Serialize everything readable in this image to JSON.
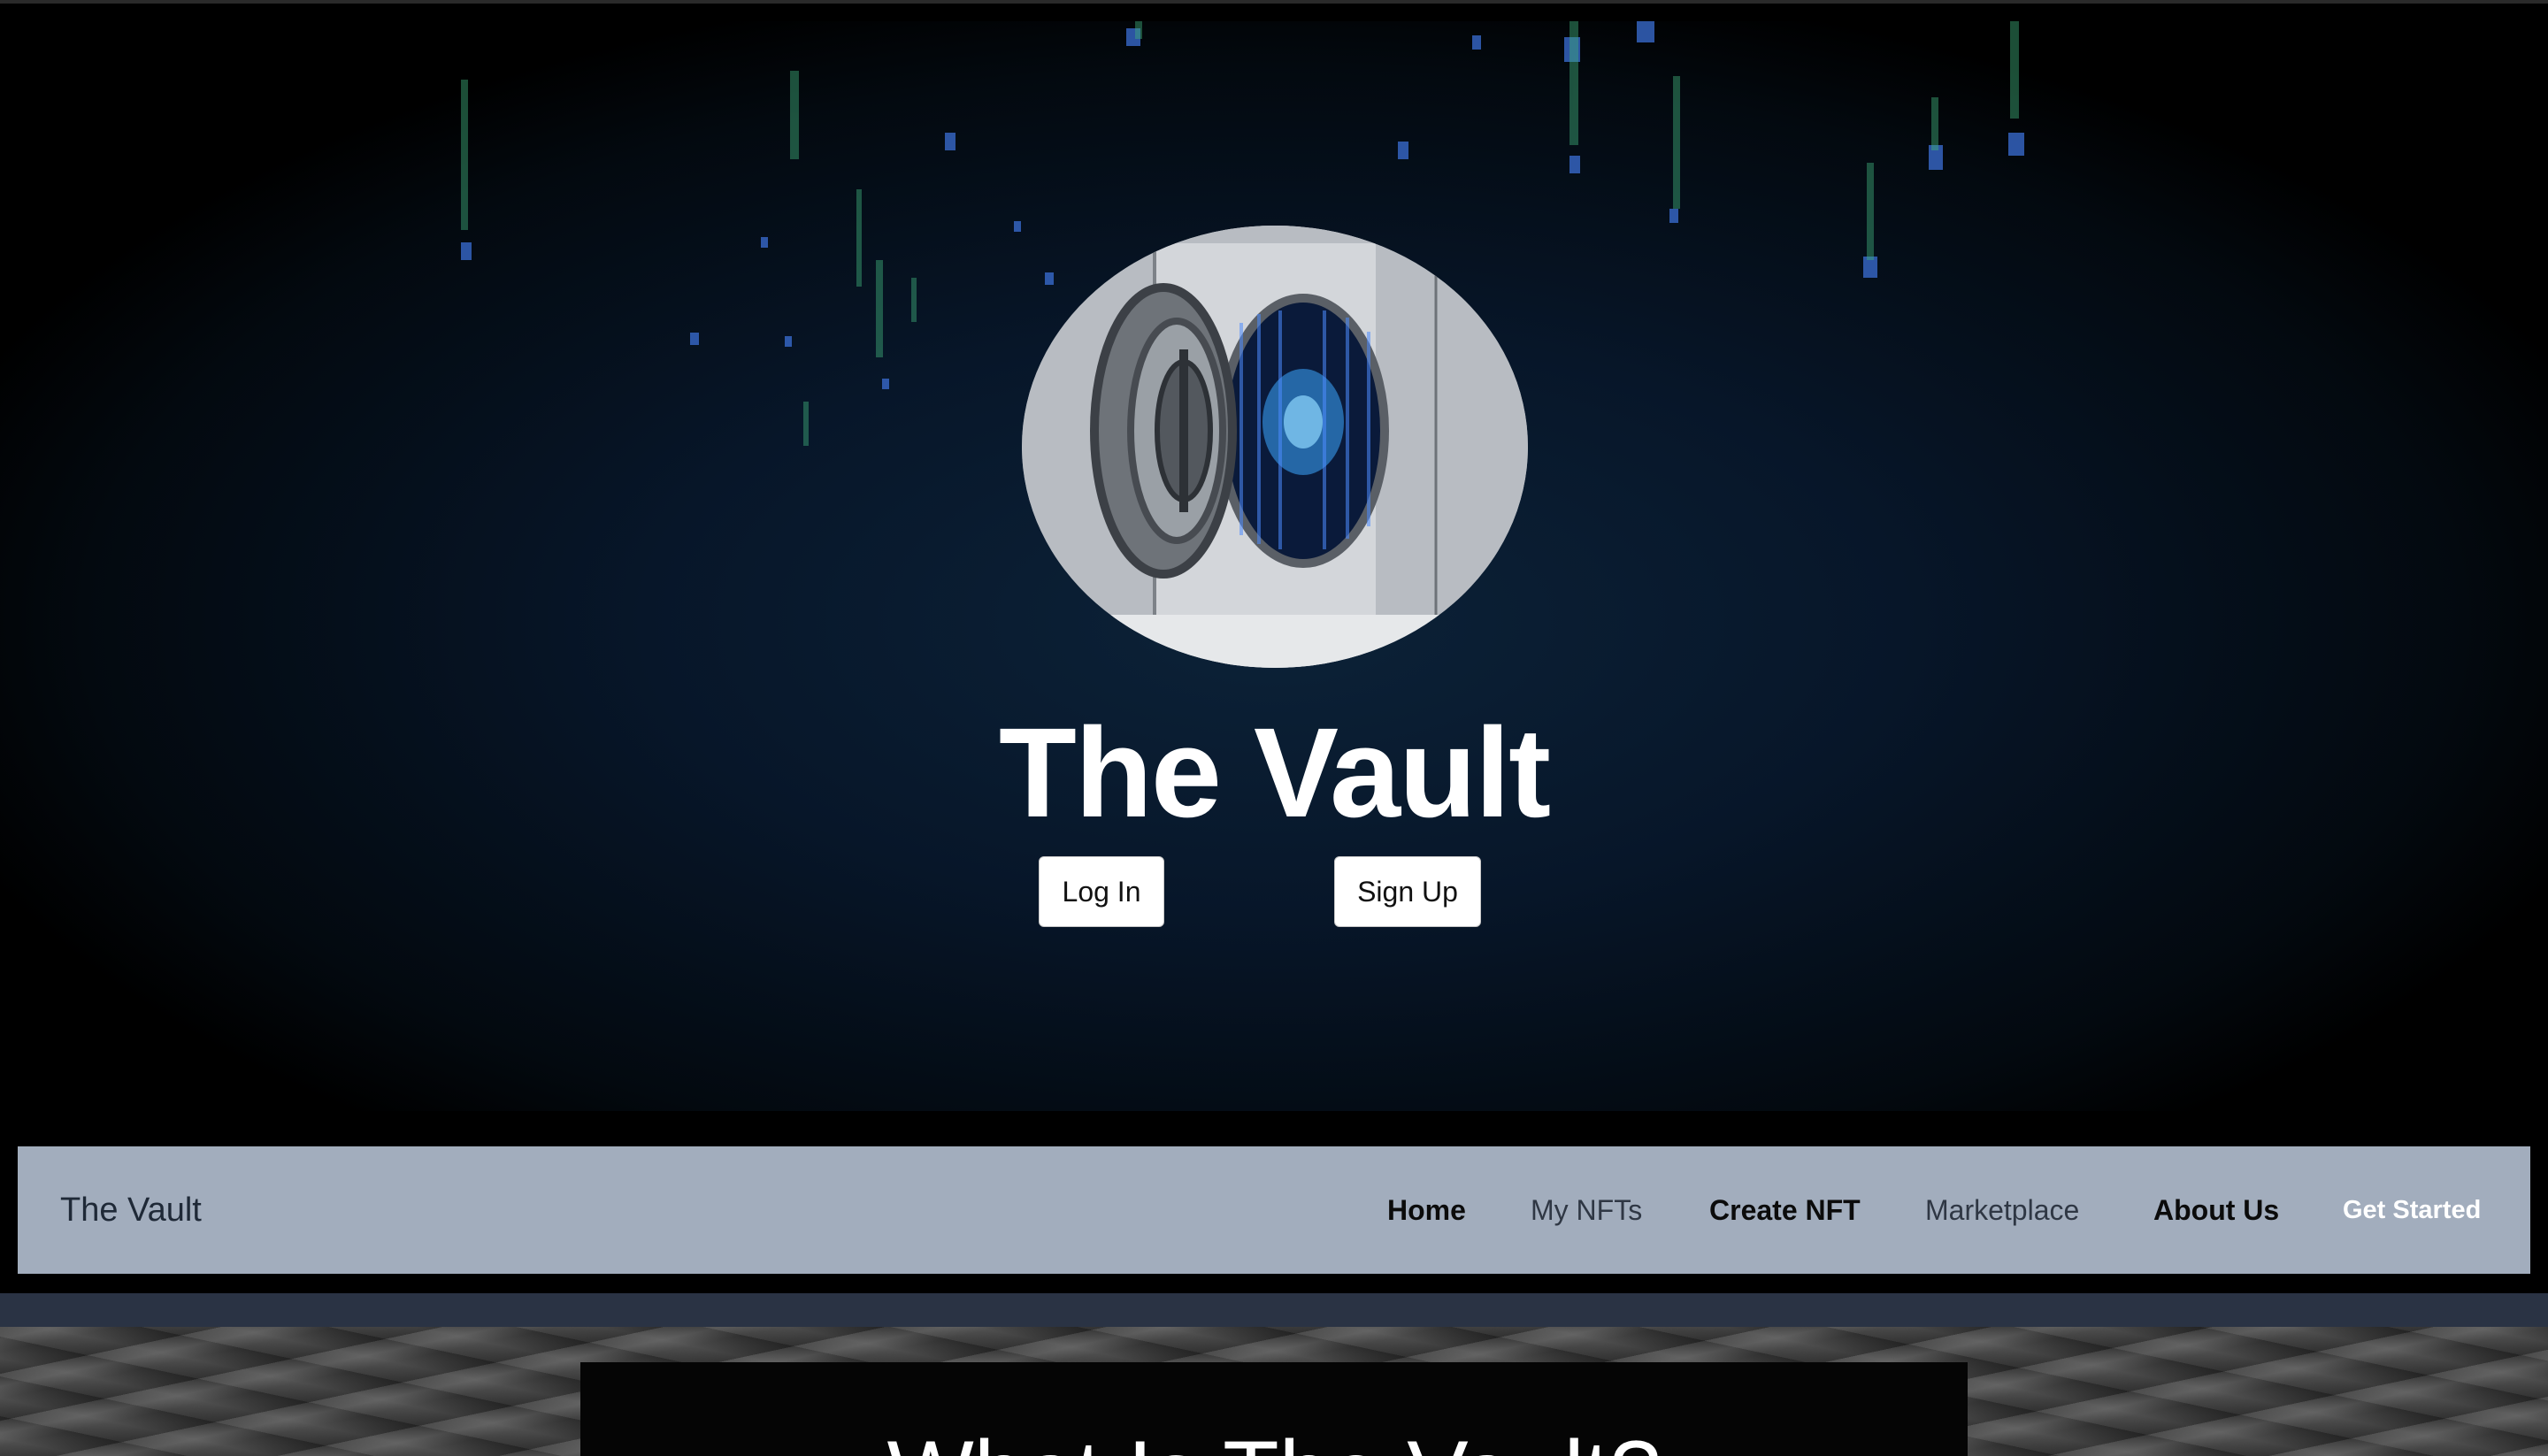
{
  "hero": {
    "title": "The Vault",
    "login_label": "Log In",
    "signup_label": "Sign Up"
  },
  "navbar": {
    "brand": "The Vault",
    "items": [
      {
        "label": "Home"
      },
      {
        "label": "My NFTs"
      },
      {
        "label": "Create NFT"
      },
      {
        "label": "Marketplace"
      },
      {
        "label": "About Us"
      }
    ],
    "cta_label": "Get Started"
  },
  "info": {
    "heading": "What Is The Vault?"
  },
  "colors": {
    "navbar_bg": "#a2adbd",
    "hero_bg": "#071629",
    "slate_band": "#2a3344",
    "rain_blue": "#3b6fd6",
    "rain_green": "#3fae7a"
  },
  "icons": {
    "hero_logo": "vault-door-icon",
    "background": "digital-rain"
  }
}
